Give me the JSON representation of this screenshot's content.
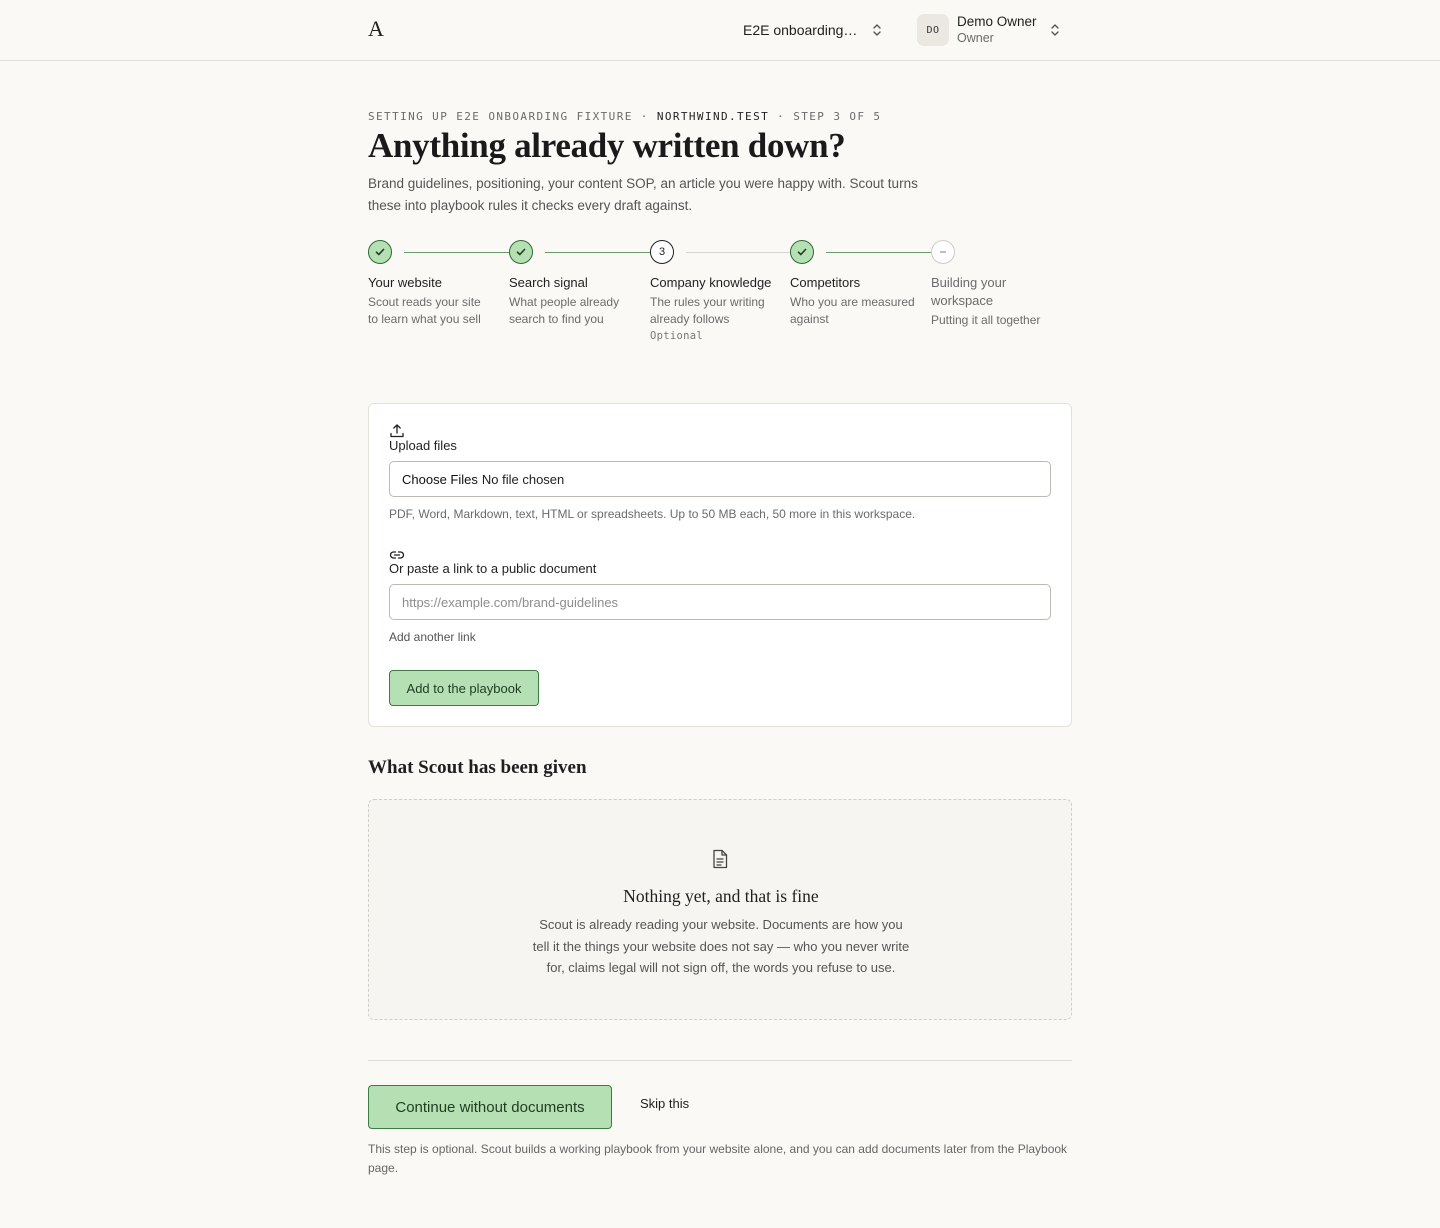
{
  "header": {
    "logo": "A",
    "workspace_name": "E2E onboarding fi…",
    "user_initials": "DO",
    "user_name": "Demo Owner",
    "user_role": "Owner"
  },
  "eyebrow": {
    "prefix": "SETTING UP E2E ONBOARDING FIXTURE · ",
    "domain": "NORTHWIND.TEST",
    "suffix": " · STEP 3 OF 5"
  },
  "page": {
    "title": "Anything already written down?",
    "intro": "Brand guidelines, positioning, your content SOP, an article you were happy with. Scout turns these into playbook rules it checks every draft against."
  },
  "steps": [
    {
      "number": "1",
      "label": "Your website",
      "desc": "Scout reads your site to learn what you sell",
      "state": "done"
    },
    {
      "number": "2",
      "label": "Search signal",
      "desc": "What people already search to find you",
      "state": "done"
    },
    {
      "number": "3",
      "label": "Company knowledge",
      "desc": "The rules your writing already follows",
      "note": "Optional",
      "state": "current"
    },
    {
      "number": "4",
      "label": "Competitors",
      "desc": "Who you are measured against",
      "state": "done"
    },
    {
      "number": "5",
      "label": "Building your workspace",
      "desc": "Putting it all together",
      "state": "pending"
    }
  ],
  "upload": {
    "label": "Upload files",
    "choose_button": "Choose Files",
    "file_status": "No file chosen",
    "hint": "PDF, Word, Markdown, text, HTML or spreadsheets. Up to 50 MB each, 50 more in this workspace.",
    "link_label": "Or paste a link to a public document",
    "link_placeholder": "https://example.com/brand-guidelines",
    "add_another": "Add another link",
    "submit": "Add to the playbook"
  },
  "given": {
    "title": "What Scout has been given",
    "empty_title": "Nothing yet, and that is fine",
    "empty_body": "Scout is already reading your website. Documents are how you tell it the things your website does not say — who you never write for, claims legal will not sign off, the words you refuse to use."
  },
  "footer": {
    "continue": "Continue without documents",
    "skip": "Skip this",
    "note": "This step is optional. Scout builds a working playbook from your website alone, and you can add documents later from the Playbook page."
  },
  "colors": {
    "accent_fill": "#b5e0b3",
    "accent_border": "#3f7a44",
    "background": "#faf9f6"
  }
}
